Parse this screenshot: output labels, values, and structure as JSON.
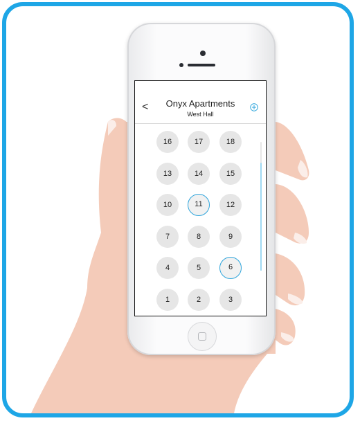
{
  "header": {
    "back_glyph": "<",
    "title": "Onyx Apartments",
    "subtitle": "West Hall",
    "add_icon": "plus-circle-icon"
  },
  "floors": {
    "rows": [
      [
        "16",
        "17",
        "18"
      ],
      [
        "13",
        "14",
        "15"
      ],
      [
        "10",
        "11",
        "12"
      ],
      [
        "7",
        "8",
        "9"
      ],
      [
        "4",
        "5",
        "6"
      ],
      [
        "1",
        "2",
        "3"
      ]
    ],
    "selected": [
      "11",
      "6"
    ]
  },
  "colors": {
    "frame_accent": "#1ea6e6",
    "selection_ring": "#2ea5dc",
    "key_fill": "#e6e6e6",
    "scroll_thumb": "#9fd9f2"
  }
}
